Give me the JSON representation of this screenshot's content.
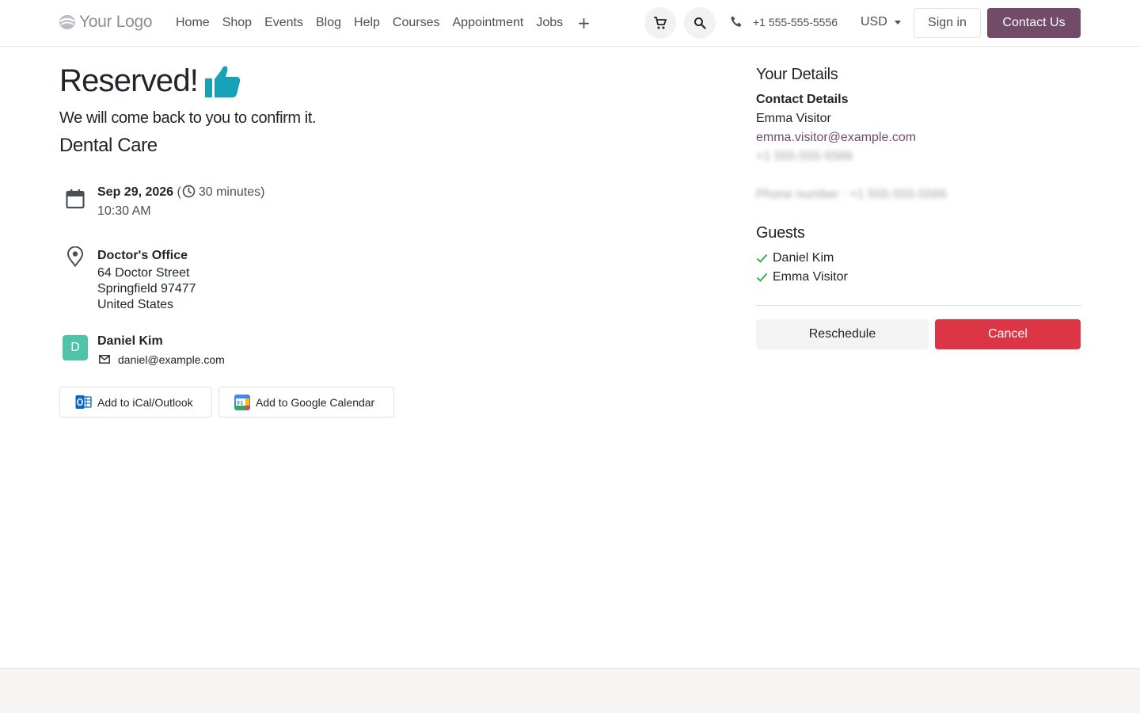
{
  "header": {
    "logo_text": "Your Logo",
    "nav": [
      "Home",
      "Shop",
      "Events",
      "Blog",
      "Help",
      "Courses",
      "Appointment",
      "Jobs"
    ],
    "add_label": "+",
    "phone": "+1 555-555-5556",
    "currency": "USD",
    "signin_label": "Sign in",
    "contact_label": "Contact Us"
  },
  "confirmation": {
    "title": "Reserved!",
    "subtitle": "We will come back to you to confirm it.",
    "appointment_name": "Dental Care",
    "date": "Sep 29, 2026",
    "paren_open": "(",
    "duration": "30 minutes)",
    "time": "10:30 AM",
    "location": {
      "name": "Doctor's Office",
      "street": "64 Doctor Street",
      "city": "Springfield 97477",
      "country": "United States"
    },
    "staff": {
      "initial": "D",
      "name": "Daniel Kim",
      "email": "daniel@example.com"
    },
    "buttons": {
      "ical": "Add to iCal/Outlook",
      "google": "Add to Google Calendar"
    }
  },
  "details": {
    "heading": "Your Details",
    "contact_heading": "Contact Details",
    "name": "Emma Visitor",
    "email": "emma.visitor@example.com",
    "phone_blurred": "+1 555-555-5566",
    "phone_row_blurred": "Phone number : +1 555-555-5566",
    "guests_heading": "Guests",
    "guests": [
      "Daniel Kim",
      "Emma Visitor"
    ],
    "reschedule_label": "Reschedule",
    "cancel_label": "Cancel"
  },
  "colors": {
    "brand": "#714b67",
    "danger": "#dc3545",
    "accent_teal": "#17a2b8",
    "avatar": "#4fc3a8",
    "success": "#28a745"
  }
}
